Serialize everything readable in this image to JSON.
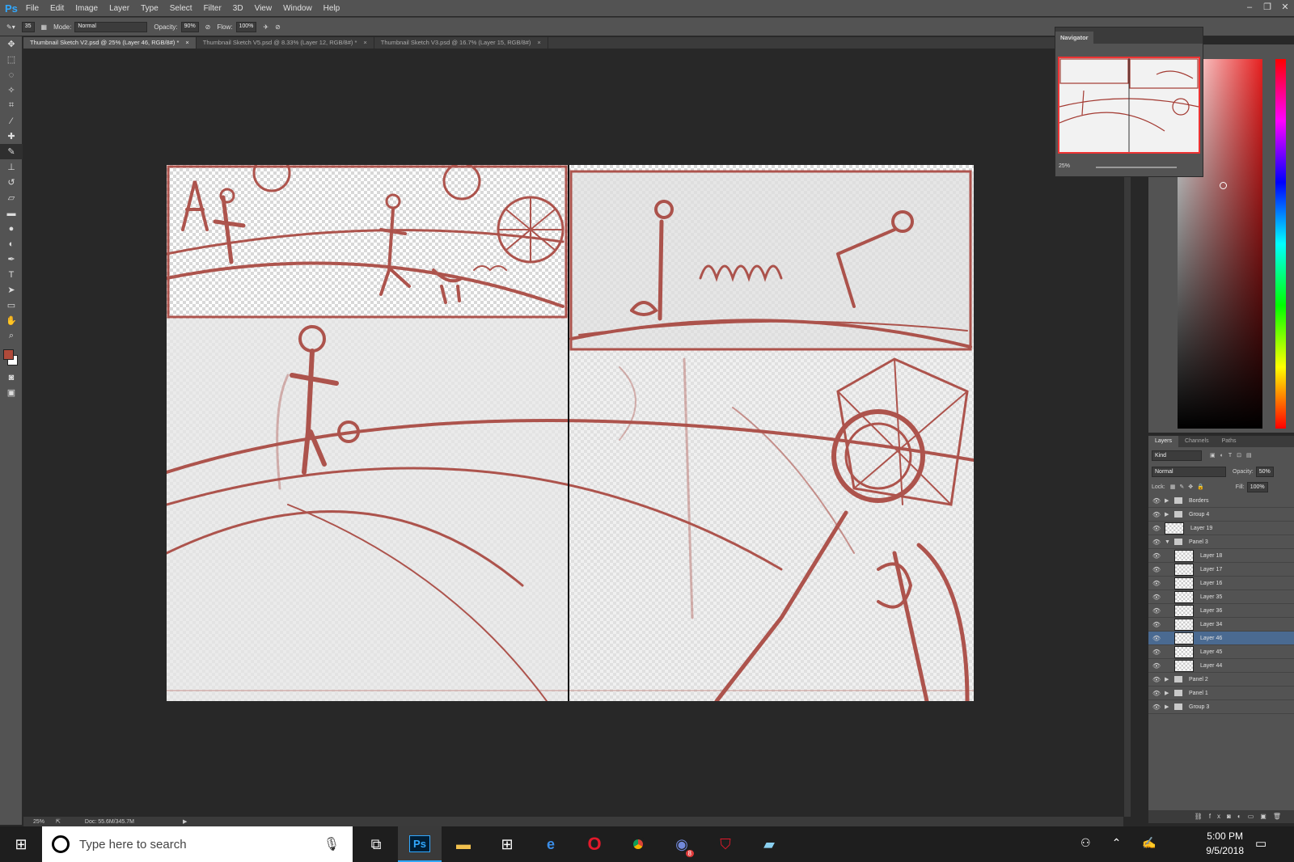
{
  "menubar": {
    "logo": "Ps",
    "items": [
      "File",
      "Edit",
      "Image",
      "Layer",
      "Type",
      "Select",
      "Filter",
      "3D",
      "View",
      "Window",
      "Help"
    ]
  },
  "window_controls": [
    "–",
    "❐",
    "✕"
  ],
  "options": {
    "brush_size": "35",
    "mode_label": "Mode:",
    "mode_value": "Normal",
    "opacity_label": "Opacity:",
    "opacity_value": "90%",
    "flow_label": "Flow:",
    "flow_value": "100%"
  },
  "tabs": [
    {
      "label": "Thumbnail Sketch V2.psd @ 25% (Layer 46, RGB/8#) *",
      "active": true
    },
    {
      "label": "Thumbnail Sketch V5.psd @ 8.33% (Layer 12, RGB/8#) *",
      "active": false
    },
    {
      "label": "Thumbnail Sketch V3.psd @ 16.7% (Layer 15, RGB/8#)",
      "active": false
    }
  ],
  "status": {
    "zoom": "25%",
    "doc": "Doc: 55.6M/345.7M"
  },
  "navigator": {
    "title": "Navigator",
    "zoom": "25%"
  },
  "layers_panel": {
    "tabs": [
      "Layers",
      "Channels",
      "Paths"
    ],
    "kind": "Kind",
    "blend": "Normal",
    "opacity_label": "Opacity:",
    "opacity": "50%",
    "lock_label": "Lock:",
    "fill_label": "Fill:",
    "fill": "100%",
    "layers": [
      {
        "name": "Borders",
        "type": "group",
        "indent": 0,
        "open": false
      },
      {
        "name": "Group 4",
        "type": "group",
        "indent": 0,
        "open": false
      },
      {
        "name": "Layer 19",
        "type": "layer",
        "indent": 0
      },
      {
        "name": "Panel 3",
        "type": "group",
        "indent": 0,
        "open": true
      },
      {
        "name": "Layer 18",
        "type": "layer",
        "indent": 1
      },
      {
        "name": "Layer 17",
        "type": "layer",
        "indent": 1
      },
      {
        "name": "Layer 16",
        "type": "layer",
        "indent": 1
      },
      {
        "name": "Layer 35",
        "type": "layer",
        "indent": 1
      },
      {
        "name": "Layer 36",
        "type": "layer",
        "indent": 1
      },
      {
        "name": "Layer 34",
        "type": "layer",
        "indent": 1
      },
      {
        "name": "Layer 46",
        "type": "layer",
        "indent": 1,
        "selected": true
      },
      {
        "name": "Layer 45",
        "type": "layer",
        "indent": 1
      },
      {
        "name": "Layer 44",
        "type": "layer",
        "indent": 1
      },
      {
        "name": "Panel 2",
        "type": "group",
        "indent": 0,
        "open": false
      },
      {
        "name": "Panel 1",
        "type": "group",
        "indent": 0,
        "open": false
      },
      {
        "name": "Group 3",
        "type": "group",
        "indent": 0,
        "open": false
      }
    ]
  },
  "taskbar": {
    "search_placeholder": "Type here to search",
    "time": "5:00 PM",
    "date": "9/5/2018",
    "badge": "8"
  },
  "colors": {
    "accent": "#31a8ff",
    "sketch": "#a33a32",
    "selected_layer": "#4a6a91",
    "foreground": "#b04a3a"
  }
}
